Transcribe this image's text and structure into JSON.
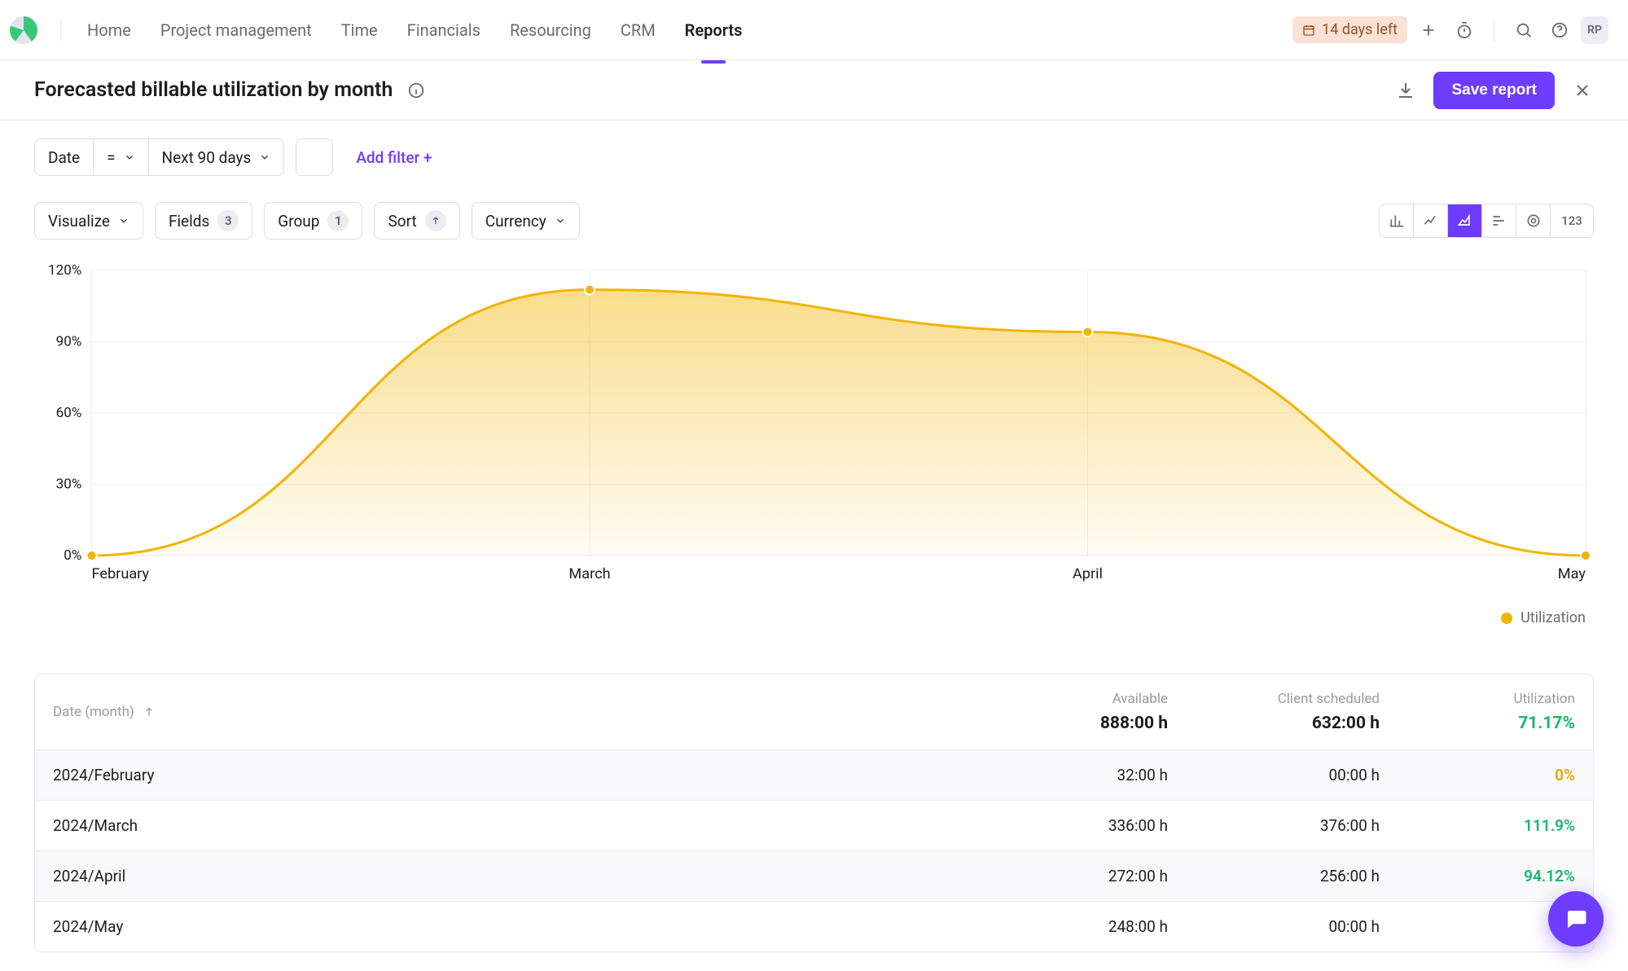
{
  "nav": {
    "items": [
      {
        "label": "Home"
      },
      {
        "label": "Project management"
      },
      {
        "label": "Time"
      },
      {
        "label": "Financials"
      },
      {
        "label": "Resourcing"
      },
      {
        "label": "CRM"
      },
      {
        "label": "Reports"
      }
    ],
    "active_index": 6,
    "trial_badge": "14 days left",
    "avatar": "RP"
  },
  "titlebar": {
    "title": "Forecasted billable utilization by month",
    "save_label": "Save report"
  },
  "filters": {
    "date_label": "Date",
    "operator": "=",
    "range": "Next 90 days",
    "add_filter": "Add filter +"
  },
  "toolbar": {
    "visualize": "Visualize",
    "fields": "Fields",
    "fields_count": "3",
    "group": "Group",
    "group_count": "1",
    "sort": "Sort",
    "currency": "Currency",
    "viz_numbers_label": "123"
  },
  "chart_data": {
    "type": "area",
    "title": "",
    "xlabel": "",
    "ylabel": "",
    "categories": [
      "February",
      "March",
      "April",
      "May"
    ],
    "series": [
      {
        "name": "Utilization",
        "values": [
          0,
          111.9,
          94.12,
          0
        ],
        "color": "#f2b400"
      }
    ],
    "ylim": [
      0,
      120
    ],
    "yticks": [
      0,
      30,
      60,
      90,
      120
    ],
    "ytick_format": "%",
    "legend": [
      "Utilization"
    ]
  },
  "table": {
    "sort_column": "Date (month)",
    "columns": [
      {
        "key": "date",
        "label": "Date (month)",
        "sorted_asc": true
      },
      {
        "key": "available",
        "label": "Available",
        "total": "888:00 h"
      },
      {
        "key": "client_scheduled",
        "label": "Client scheduled",
        "total": "632:00 h"
      },
      {
        "key": "utilization",
        "label": "Utilization",
        "total": "71.17%"
      }
    ],
    "rows": [
      {
        "date": "2024/February",
        "available": "32:00 h",
        "client_scheduled": "00:00 h",
        "utilization": "0%",
        "util_class": "util-yellow"
      },
      {
        "date": "2024/March",
        "available": "336:00 h",
        "client_scheduled": "376:00 h",
        "utilization": "111.9%",
        "util_class": "util-green"
      },
      {
        "date": "2024/April",
        "available": "272:00 h",
        "client_scheduled": "256:00 h",
        "utilization": "94.12%",
        "util_class": "util-green"
      },
      {
        "date": "2024/May",
        "available": "248:00 h",
        "client_scheduled": "00:00 h",
        "utilization": "",
        "util_class": ""
      }
    ]
  }
}
